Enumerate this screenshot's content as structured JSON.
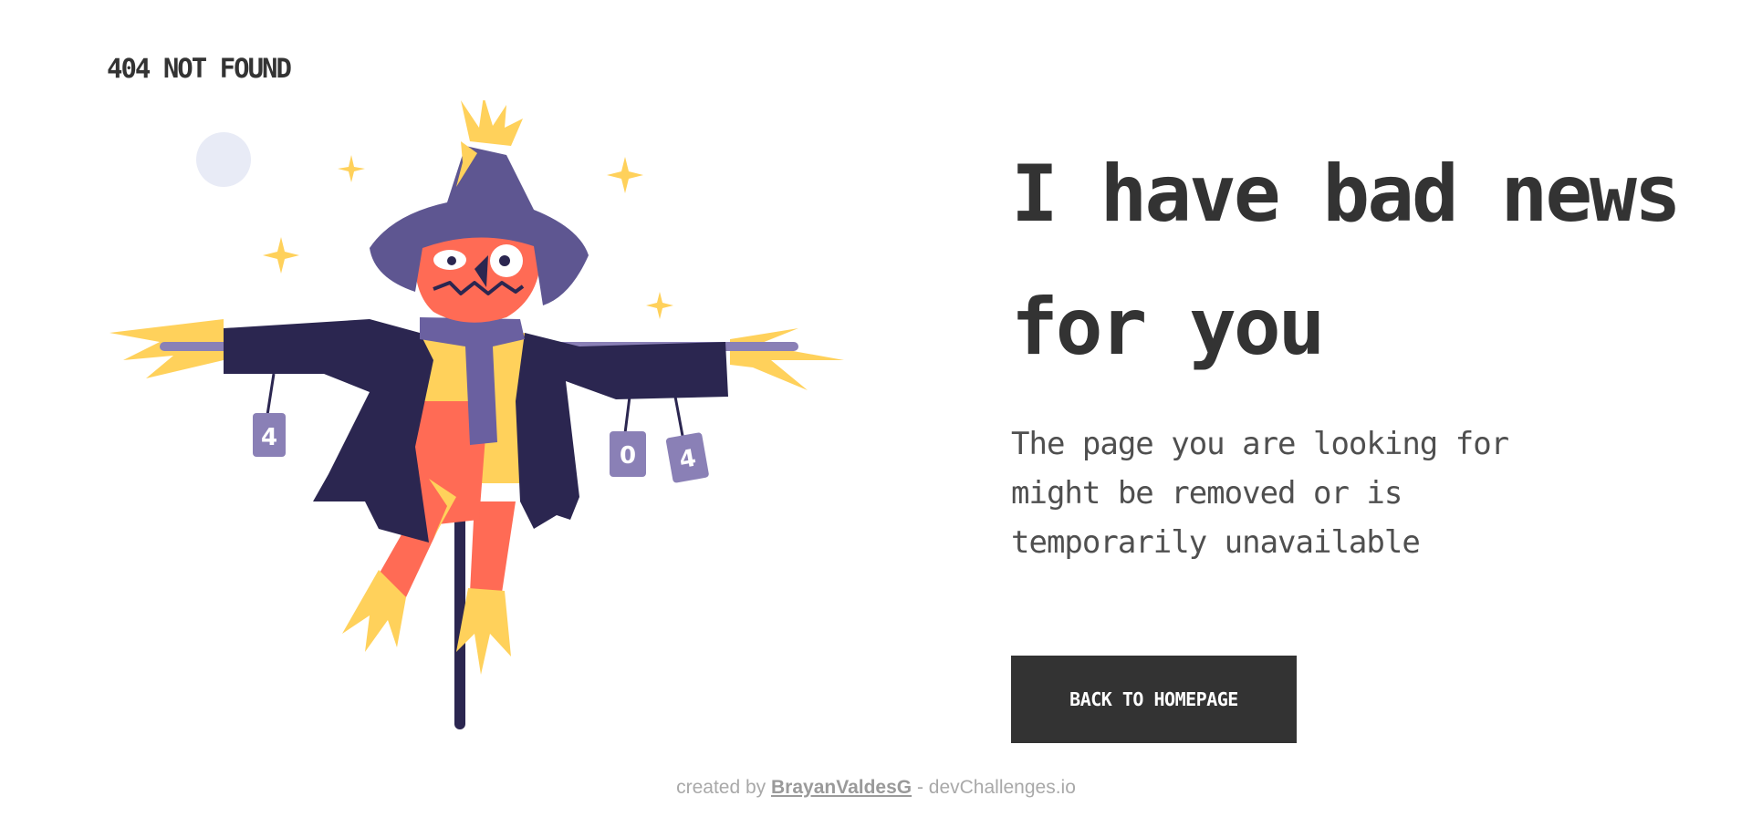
{
  "header": {
    "brand": "404 NOT FOUND"
  },
  "illustration": {
    "can_labels": [
      "4",
      "0",
      "4"
    ]
  },
  "main": {
    "headline": "I have bad news for you",
    "description": "The page you are looking for might be removed or is temporarily unavailable",
    "button_label": "BACK TO HOMEPAGE"
  },
  "footer": {
    "prefix": "created by",
    "author": "BrayanValdesG",
    "suffix": "- devChallenges.io"
  },
  "colors": {
    "text": "#333333",
    "button_bg": "#333333",
    "hat": "#5e5691",
    "coat": "#2b2650",
    "pumpkin": "#ff6b55",
    "straw": "#ffd15b",
    "moon": "#e8ebf6",
    "can": "#8a80b6"
  }
}
